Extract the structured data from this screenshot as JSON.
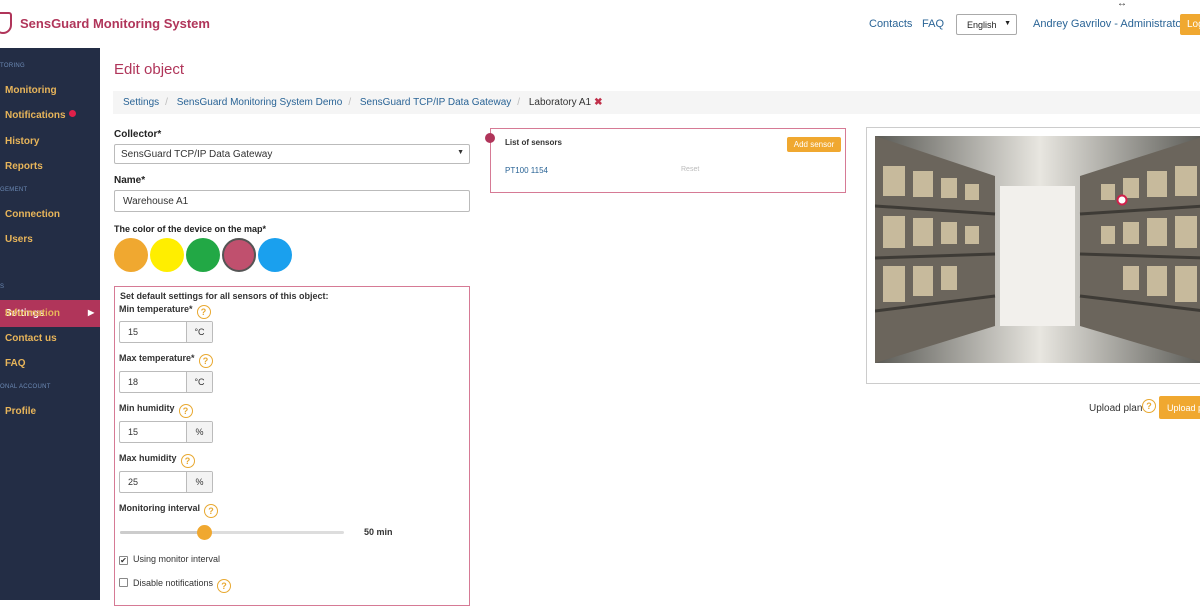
{
  "app": {
    "title": "SensGuard Monitoring System"
  },
  "topnav": {
    "contacts": "Contacts",
    "faq": "FAQ",
    "language": "English",
    "user": "Andrey Gavrilov - Administrator",
    "logout": "Log"
  },
  "sidebar": {
    "sections": [
      "TORING",
      "GEMENT",
      "S",
      "ONAL ACCOUNT"
    ],
    "items": {
      "monitoring": "Monitoring",
      "notifications": "Notifications",
      "history": "History",
      "reports": "Reports",
      "connection": "Connection",
      "users": "Users",
      "settings": "Settings",
      "information": "Information",
      "contact": "Contact us",
      "faq": "FAQ",
      "profile": "Profile"
    }
  },
  "page": {
    "title": "Edit object"
  },
  "breadcrumb": [
    "Settings",
    "SensGuard Monitoring System Demo",
    "SensGuard TCP/IP Data Gateway",
    "Laboratory A1"
  ],
  "form": {
    "collector_label": "Collector*",
    "collector_value": "SensGuard TCP/IP Data Gateway",
    "name_label": "Name*",
    "name_value": "Warehouse A1",
    "color_label": "The color of the device on the map*",
    "colors": [
      "#f0a830",
      "#ffee00",
      "#22a845",
      "#c0506e",
      "#1aa0ee"
    ],
    "selected_color": "#c0506e"
  },
  "defaults": {
    "title": "Set default settings for all sensors of this object:",
    "min_temp_label": "Min temperature*",
    "min_temp": "15",
    "temp_unit": "°C",
    "max_temp_label": "Max temperature*",
    "max_temp": "18",
    "min_hum_label": "Min humidity",
    "min_hum": "15",
    "hum_unit": "%",
    "max_hum_label": "Max humidity",
    "max_hum": "25",
    "interval_label": "Monitoring interval",
    "interval_value": "50 min",
    "interval_fraction": 0.375,
    "use_monitor_interval": "Using monitor interval",
    "use_monitor_checked": true,
    "disable_notifications": "Disable notifications",
    "disable_checked": false,
    "help": "?"
  },
  "sensors": {
    "title": "List of sensors",
    "add": "Add sensor",
    "rows": [
      {
        "name": "PT100 1154",
        "action": "Reset"
      }
    ]
  },
  "plan": {
    "upload_label": "Upload plan",
    "upload_button": "Upload p"
  }
}
